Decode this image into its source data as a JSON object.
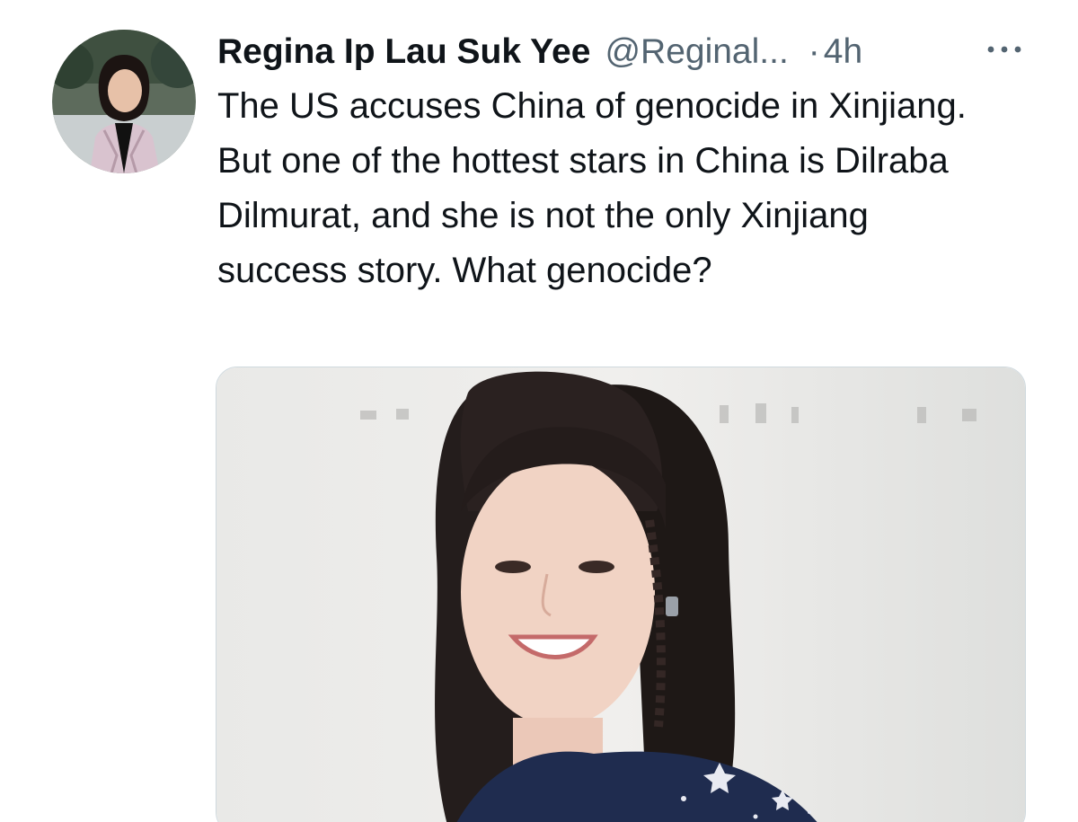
{
  "tweet": {
    "author_name": "Regina Ip Lau Suk Yee",
    "author_handle": "@Reginal...",
    "separator": "·",
    "timestamp": "4h",
    "more_icon": "more-horizontal-icon",
    "text": "The US accuses China of genocide in Xinjiang. But one of the hottest stars in China is Dilraba Dilmurat, and she is not the only Xinjiang success story. What genocide?"
  },
  "colors": {
    "primary_text": "#0f1419",
    "secondary_text": "#536471",
    "media_border": "#cfd9de"
  }
}
